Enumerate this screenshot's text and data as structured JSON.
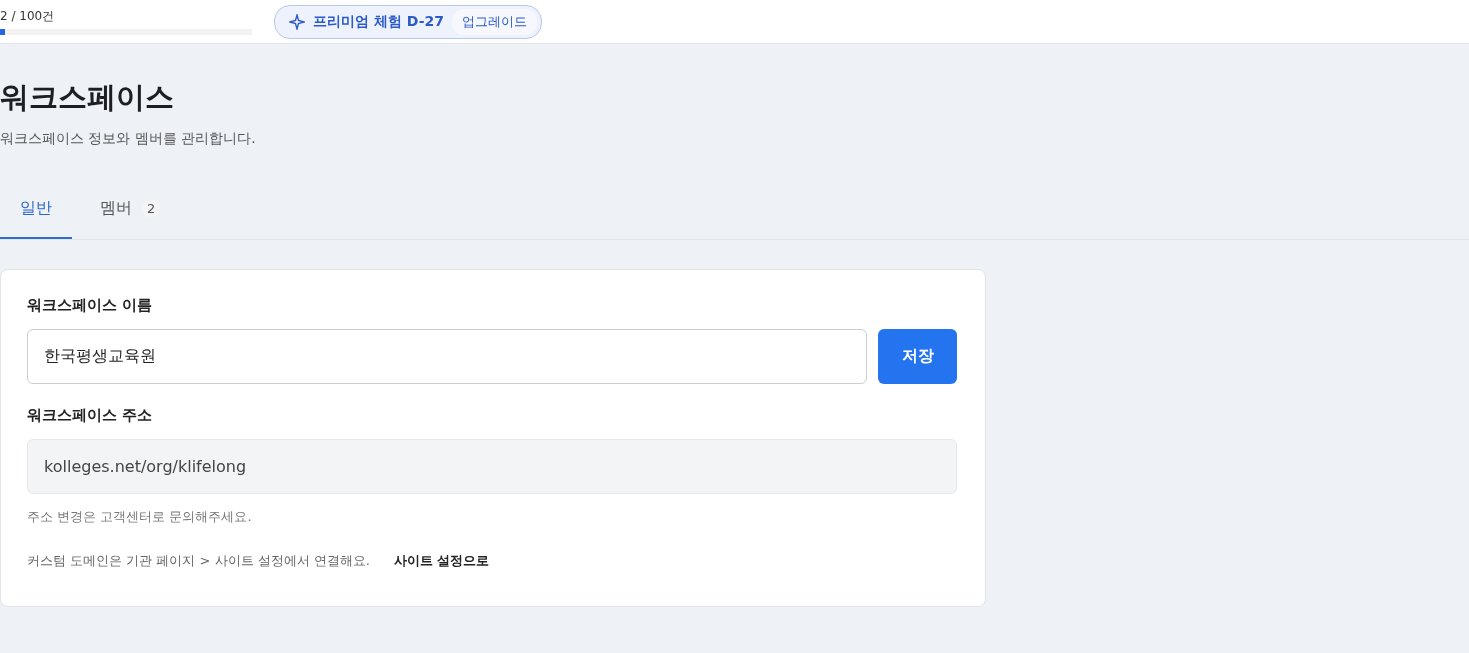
{
  "top_bar": {
    "usage": {
      "label": "2 / 100건",
      "level": 0.02
    },
    "premium": {
      "label": "프리미엄 체험 D-27",
      "action": "업그레이드"
    }
  },
  "header": {
    "title": "워크스페이스",
    "subtitle": "워크스페이스 정보와 멤버를 관리합니다."
  },
  "tabs": [
    {
      "label": "일반",
      "selected": true
    },
    {
      "label": "멤버",
      "count": "2",
      "selected": false
    }
  ],
  "card": {
    "name_label": "워크스페이스 이름",
    "name_value": "한국평생교육원",
    "save": "저장",
    "address_label": "워크스페이스 주소",
    "address_value": "kolleges.net/org/klifelong",
    "address_hint": "주소 변경은 고객센터로 문의해주세요.",
    "domain_hint": "커스텀 도메인은 기관 페이지 > 사이트 설정에서 연결해요.",
    "domain_link": "사이트 설정으로"
  }
}
